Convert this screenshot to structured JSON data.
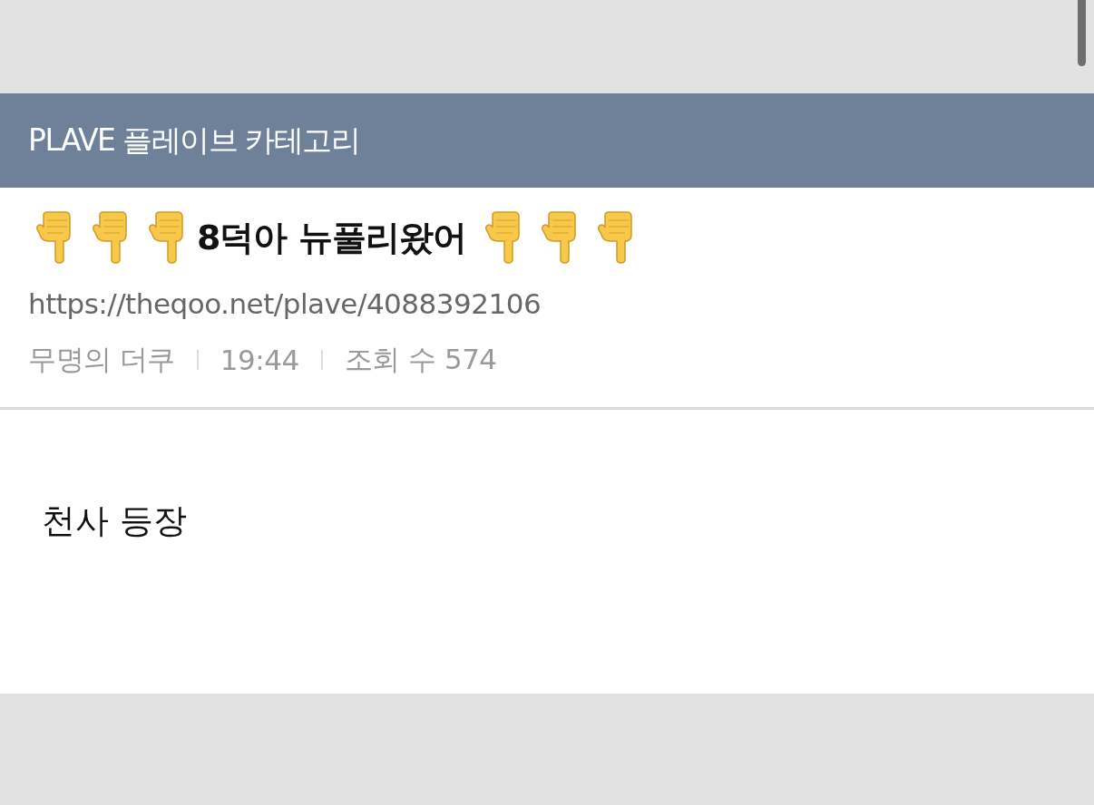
{
  "category_bar": {
    "title": "PLAVE 플레이브 카테고리"
  },
  "post": {
    "title": {
      "icons_before": [
        {
          "kind": "pointing-down-hand"
        },
        {
          "kind": "pointing-down-hand"
        },
        {
          "kind": "pointing-down-hand"
        }
      ],
      "text": "8덕아 뉴풀리왔어",
      "icons_after": [
        {
          "kind": "pointing-down-hand"
        },
        {
          "kind": "pointing-down-hand"
        },
        {
          "kind": "pointing-down-hand"
        }
      ]
    },
    "url": "https://theqoo.net/plave/4088392106",
    "meta": [
      "무명의 더쿠",
      "19:44",
      "조회 수 574"
    ],
    "body": "천사 등장"
  }
}
